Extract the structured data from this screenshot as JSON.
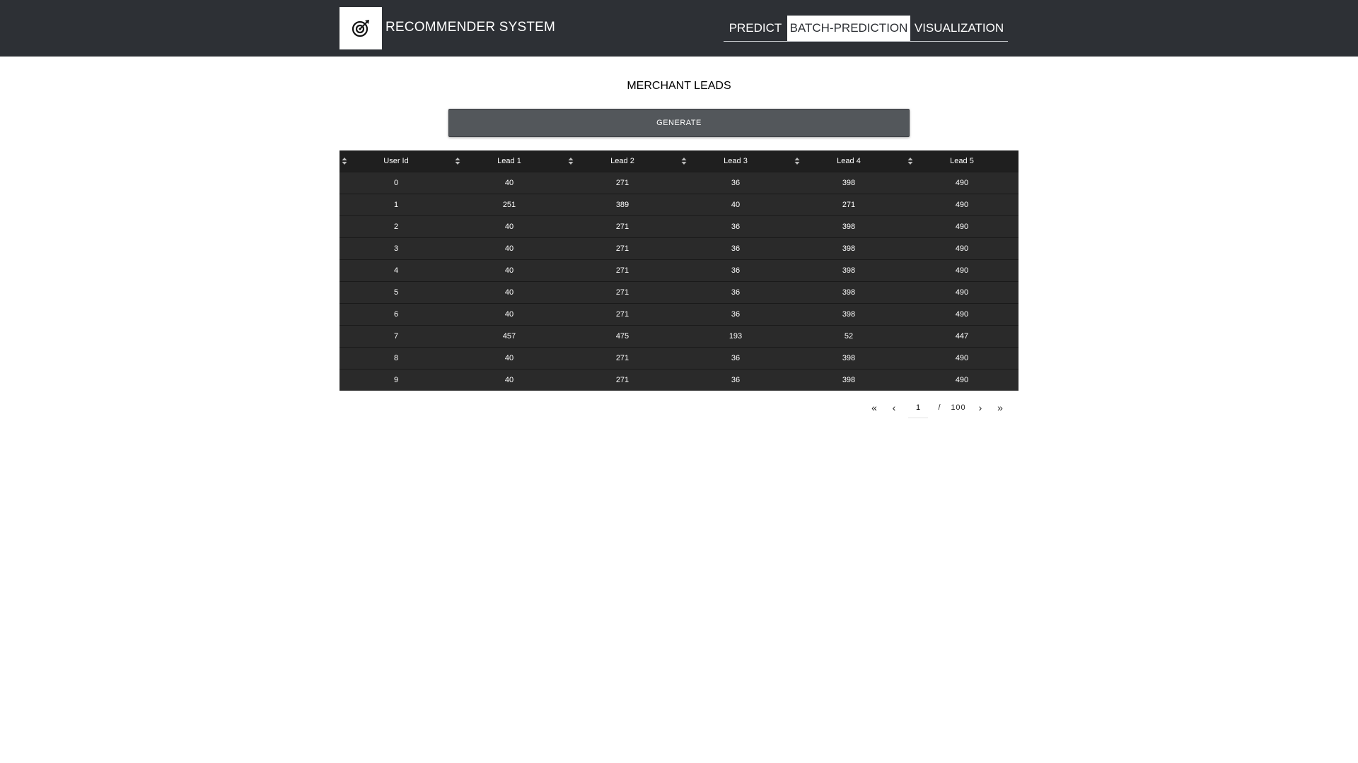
{
  "app": {
    "title": "RECOMMENDER SYSTEM",
    "logo_icon": "target-icon"
  },
  "nav": {
    "tabs": [
      {
        "label": "PREDICT",
        "active": false
      },
      {
        "label": "BATCH-PREDICTION",
        "active": true
      },
      {
        "label": "VISUALIZATION",
        "active": false
      }
    ]
  },
  "main": {
    "heading": "MERCHANT LEADS",
    "generate_label": "GENERATE"
  },
  "table": {
    "columns": [
      "User Id",
      "Lead 1",
      "Lead 2",
      "Lead 3",
      "Lead 4",
      "Lead 5"
    ],
    "rows": [
      [
        "0",
        "40",
        "271",
        "36",
        "398",
        "490"
      ],
      [
        "1",
        "251",
        "389",
        "40",
        "271",
        "490"
      ],
      [
        "2",
        "40",
        "271",
        "36",
        "398",
        "490"
      ],
      [
        "3",
        "40",
        "271",
        "36",
        "398",
        "490"
      ],
      [
        "4",
        "40",
        "271",
        "36",
        "398",
        "490"
      ],
      [
        "5",
        "40",
        "271",
        "36",
        "398",
        "490"
      ],
      [
        "6",
        "40",
        "271",
        "36",
        "398",
        "490"
      ],
      [
        "7",
        "457",
        "475",
        "193",
        "52",
        "447"
      ],
      [
        "8",
        "40",
        "271",
        "36",
        "398",
        "490"
      ],
      [
        "9",
        "40",
        "271",
        "36",
        "398",
        "490"
      ]
    ]
  },
  "pagination": {
    "first": "«",
    "prev": "‹",
    "current": "1",
    "separator": "/",
    "total": "100",
    "next": "›",
    "last": "»"
  }
}
